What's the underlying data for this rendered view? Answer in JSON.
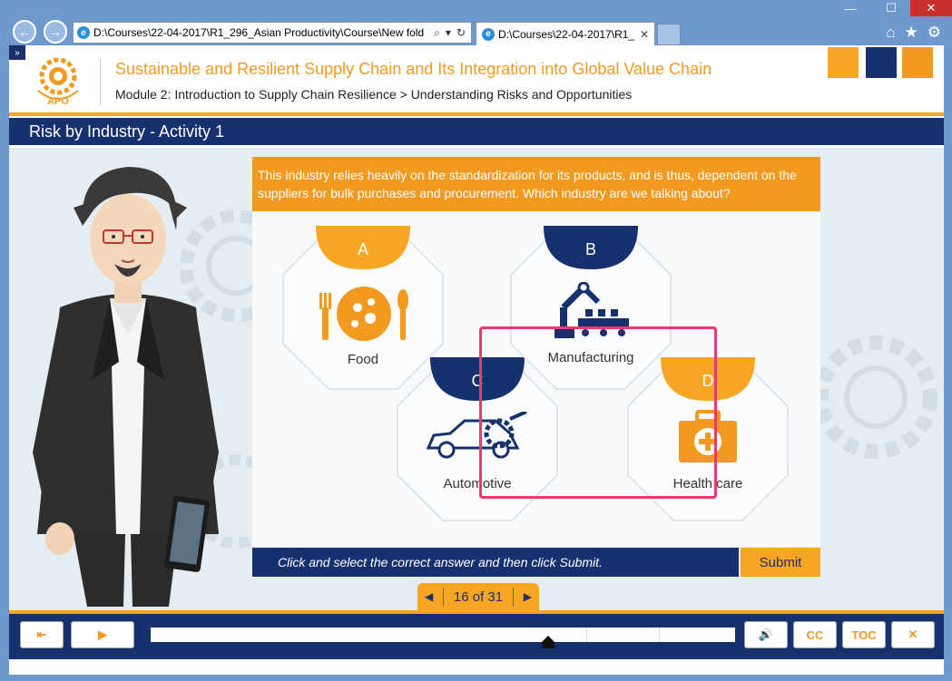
{
  "browser": {
    "address": "D:\\Courses\\22-04-2017\\R1_296_Asian Productivity\\Course\\New fold",
    "tab_title": "D:\\Courses\\22-04-2017\\R1_...",
    "tab_close": "✕",
    "window_controls": [
      "—",
      "☐",
      "✕"
    ]
  },
  "course": {
    "logo_text": "APO",
    "title": "Sustainable and Resilient Supply Chain and Its Integration into Global Value Chain",
    "module": "Module 2: Introduction to Supply Chain Resilience > Understanding Risks and Opportunities",
    "header_colors": [
      "#f6a623",
      "#17306e",
      "#f29a1f"
    ]
  },
  "slide": {
    "title": "Risk by Industry - Activity 1",
    "question": "This industry relies heavily on the standardization for its products, and is thus, dependent on the suppliers for bulk purchases and procurement. Which industry are we talking about?",
    "options": [
      {
        "letter": "A",
        "label": "Food",
        "icon": "food-icon",
        "badge_color": "#f6a623"
      },
      {
        "letter": "B",
        "label": "Manufacturing",
        "icon": "robot-arm-icon",
        "badge_color": "#17306e"
      },
      {
        "letter": "C",
        "label": "Automotive",
        "icon": "car-gear-icon",
        "badge_color": "#17306e"
      },
      {
        "letter": "D",
        "label": "Health care",
        "icon": "medical-kit-icon",
        "badge_color": "#f6a623"
      }
    ],
    "selected": "B",
    "instruction": "Click and select the correct answer and then click Submit.",
    "submit_label": "Submit",
    "pager": {
      "current": 16,
      "total": 31,
      "text": "16 of 31"
    }
  },
  "player": {
    "exit_label": "⇤",
    "play_label": "▶",
    "volume_label": "🔊",
    "cc_label": "CC",
    "toc_label": "TOC",
    "close_label": "✕",
    "progress_fraction": 0.68
  }
}
